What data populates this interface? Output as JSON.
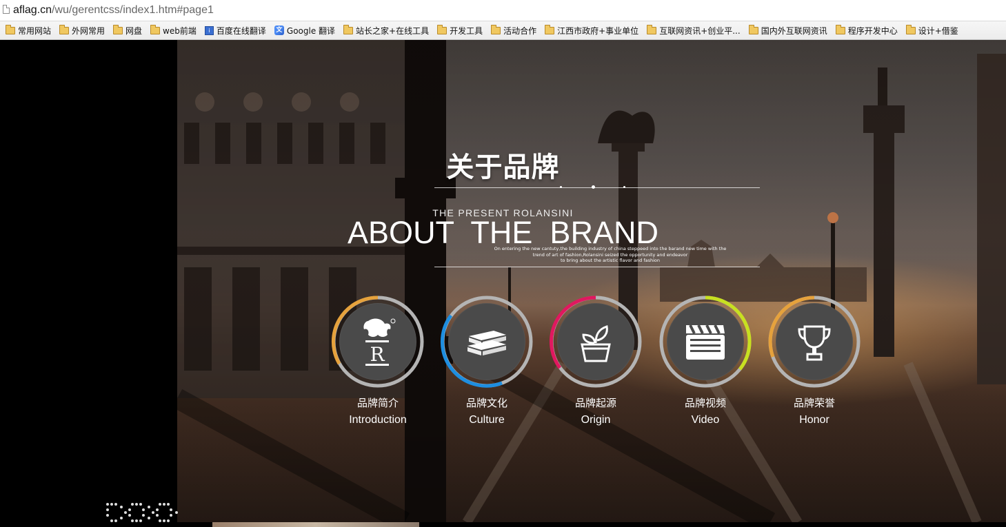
{
  "browser": {
    "url_domain": "aflag.cn",
    "url_path": "/wu/gerentcss/index1.htm#page1",
    "bookmarks": [
      {
        "label": "常用网站",
        "icon": "folder-icon"
      },
      {
        "label": "外网常用",
        "icon": "folder-icon"
      },
      {
        "label": "网盘",
        "icon": "folder-icon"
      },
      {
        "label": "web前端",
        "icon": "folder-icon"
      },
      {
        "label": "百度在线翻译",
        "icon": "translate-icon"
      },
      {
        "label": "Google 翻译",
        "icon": "google-translate-icon"
      },
      {
        "label": "站长之家+在线工具",
        "icon": "folder-icon"
      },
      {
        "label": "开发工具",
        "icon": "folder-icon"
      },
      {
        "label": "活动合作",
        "icon": "folder-icon"
      },
      {
        "label": "江西市政府+事业单位",
        "icon": "folder-icon"
      },
      {
        "label": "互联网资讯+创业平...",
        "icon": "folder-icon"
      },
      {
        "label": "国内外互联网资讯",
        "icon": "folder-icon"
      },
      {
        "label": "程序开发中心",
        "icon": "folder-icon"
      },
      {
        "label": "设计+借鉴",
        "icon": "folder-icon"
      }
    ]
  },
  "hero": {
    "title_cn": "关于品牌",
    "subtitle_small": "THE PRESENT ROLANSINI",
    "subtitle_big": "ABOUT  THE  BRAND",
    "desc_line1": "On entering the new cantuty,the building industry of china steppeed into the barand new time with the",
    "desc_line2": "trend of art of fashion,Rolansini seized the opportunity and endeavor",
    "desc_line3": "to bring about the artistic flavor and fashion"
  },
  "features": [
    {
      "cn": "品牌简介",
      "en": "Introduction",
      "icon": "griffin-logo-icon",
      "ring_color": "#e6a23c"
    },
    {
      "cn": "品牌文化",
      "en": "Culture",
      "icon": "books-icon",
      "ring_color": "#1e8ee0"
    },
    {
      "cn": "品牌起源",
      "en": "Origin",
      "icon": "plant-pot-icon",
      "ring_color": "#e0185f"
    },
    {
      "cn": "品牌视频",
      "en": "Video",
      "icon": "clapperboard-icon",
      "ring_color": "#c8e020"
    },
    {
      "cn": "品牌荣誉",
      "en": "Honor",
      "icon": "trophy-icon",
      "ring_color": "#e6a23c"
    }
  ],
  "colors": {
    "ring_base": "#b4b4b4",
    "disc": "#4a4a4a"
  }
}
